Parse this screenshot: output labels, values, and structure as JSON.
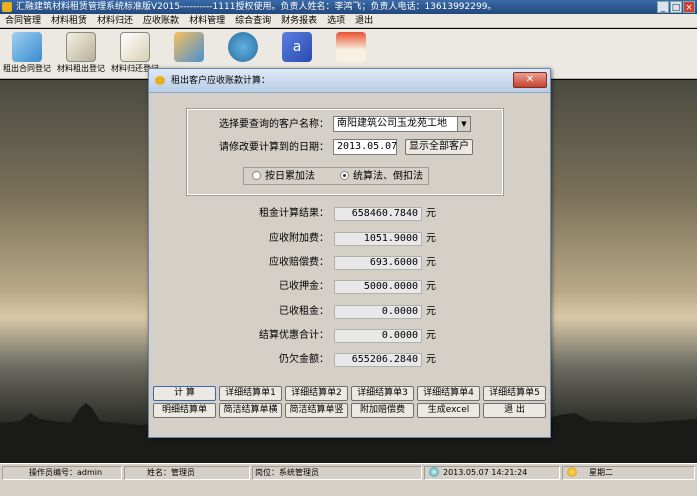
{
  "window": {
    "title": "汇融建筑材料租赁管理系统标准版V2015----------1111授权使用。负责人姓名：李鸿飞；负责人电话：13613992299。"
  },
  "menu": [
    "合同管理",
    "材料租赁",
    "材料归还",
    "应收账款",
    "材料管理",
    "综合查询",
    "财务报表",
    "选项",
    "退出"
  ],
  "toolbar": [
    {
      "label": "租出合同登记",
      "icon": "contract-register-icon"
    },
    {
      "label": "材料租出登记",
      "icon": "material-rental-icon"
    },
    {
      "label": "材料归还登记",
      "icon": "material-return-icon"
    },
    {
      "label": "",
      "icon": "tools-icon"
    },
    {
      "label": "",
      "icon": "settings-globe-icon"
    },
    {
      "label": "",
      "icon": "address-book-icon"
    },
    {
      "label": "",
      "icon": "home-icon"
    }
  ],
  "dialog": {
    "title": "租出客户应收账款计算：",
    "customer_label": "选择要查询的客户名称：",
    "customer_value": "南阳建筑公司玉龙苑工地",
    "date_label": "请修改要计算到的日期：",
    "date_value": "2013.05.07",
    "show_all_button": "显示全部客户",
    "radio_daily": "按日累加法",
    "radio_stat": "统算法、倒扣法",
    "fields": [
      {
        "label": "租金计算结果：",
        "value": "658460.7840",
        "unit": "元"
      },
      {
        "label": "应收附加费：",
        "value": "1051.9000",
        "unit": "元"
      },
      {
        "label": "应收赔偿费：",
        "value": "693.6000",
        "unit": "元"
      },
      {
        "label": "已收押金：",
        "value": "5000.0000",
        "unit": "元"
      },
      {
        "label": "已收租金：",
        "value": "0.0000",
        "unit": "元"
      },
      {
        "label": "结算优惠合计：",
        "value": "0.0000",
        "unit": "元"
      },
      {
        "label": "仍欠金额：",
        "value": "655206.2840",
        "unit": "元"
      }
    ],
    "buttons_row1": [
      "计  算",
      "详细结算单1",
      "详细结算单2",
      "详细结算单3",
      "详细结算单4",
      "详细结算单5"
    ],
    "buttons_row2": [
      "明细结算单",
      "简洁结算单横",
      "简洁结算单竖",
      "附加赔偿费",
      "生成excel",
      "退  出"
    ]
  },
  "statusbar": {
    "operator": "操作员编号：admin",
    "name": "姓名：管理员",
    "post": "岗位：系统管理员",
    "datetime": "2013.05.07  14:21:24",
    "weekday": "星期二"
  },
  "colors": {
    "dialog_bg": "#d4d0c8",
    "title_accent": "#23487a"
  }
}
